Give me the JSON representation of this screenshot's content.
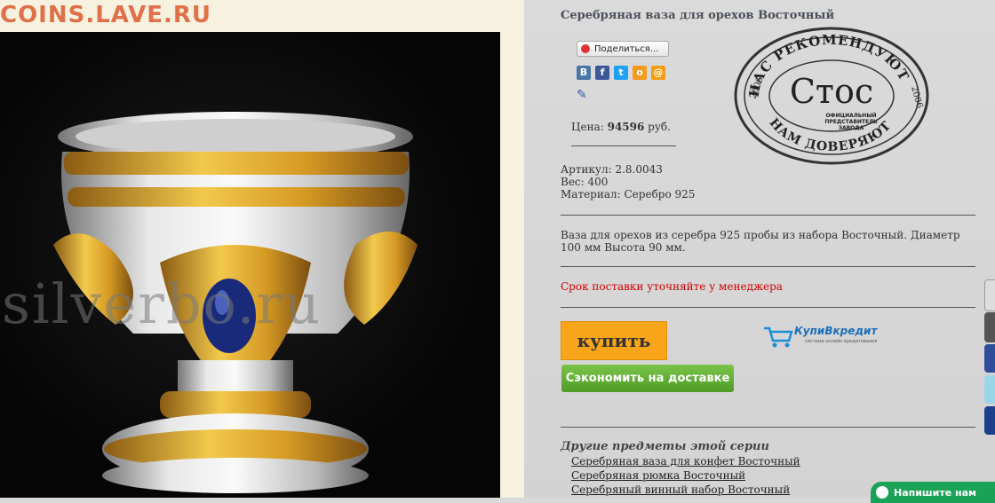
{
  "site_watermark": "COINS.LAVE.RU",
  "photo_watermark": "silverbo.ru",
  "product": {
    "title": "Серебряная ваза для орехов Восточный",
    "share_label": "Поделиться...",
    "price_label": "Цена:",
    "price_value": "94596",
    "price_currency": "руб.",
    "article": "Артикул: 2.8.0043",
    "weight": "Вес: 400",
    "material": "Материал: Серебро 925",
    "description": "Ваза для орехов из серебра 925 пробы из набора Восточный. Диаметр 100 мм Высота 90 мм.",
    "delivery_note": "Срок поставки уточняйте у менеджера",
    "buy_label": "купить",
    "ship_label": "Сэкономить на доставке"
  },
  "credit": {
    "name": "КупиВкредит",
    "tagline": "система онлайн кредитования"
  },
  "stamp": {
    "top": "НАС РЕКОМЕНДУЮТ",
    "bottom": "НАМ ДОВЕРЯЮТ !",
    "brand": "Стос",
    "sub1": "ОФИЦИАЛЬНЫЙ",
    "sub2": "ПРЕДСТАВИТЕЛЬ",
    "sub3": "ЗАВОДА",
    "year_left": "2006",
    "year_right": "2006"
  },
  "social": [
    {
      "icon": "vkontakte-icon",
      "glyph": "В",
      "color": "#4a76a8"
    },
    {
      "icon": "facebook-icon",
      "glyph": "f",
      "color": "#3b5998"
    },
    {
      "icon": "twitter-icon",
      "glyph": "t",
      "color": "#1da1f2"
    },
    {
      "icon": "odnoklassniki-icon",
      "glyph": "о",
      "color": "#f59a1b"
    },
    {
      "icon": "mailru-icon",
      "glyph": "@",
      "color": "#f39c12"
    }
  ],
  "series": {
    "title": "Другие предметы этой серии",
    "items": [
      "Серебряная ваза для конфет Восточный",
      "Серебряная рюмка Восточный",
      "Серебряный винный набор Восточный"
    ]
  },
  "chat_label": "Напишите нам"
}
